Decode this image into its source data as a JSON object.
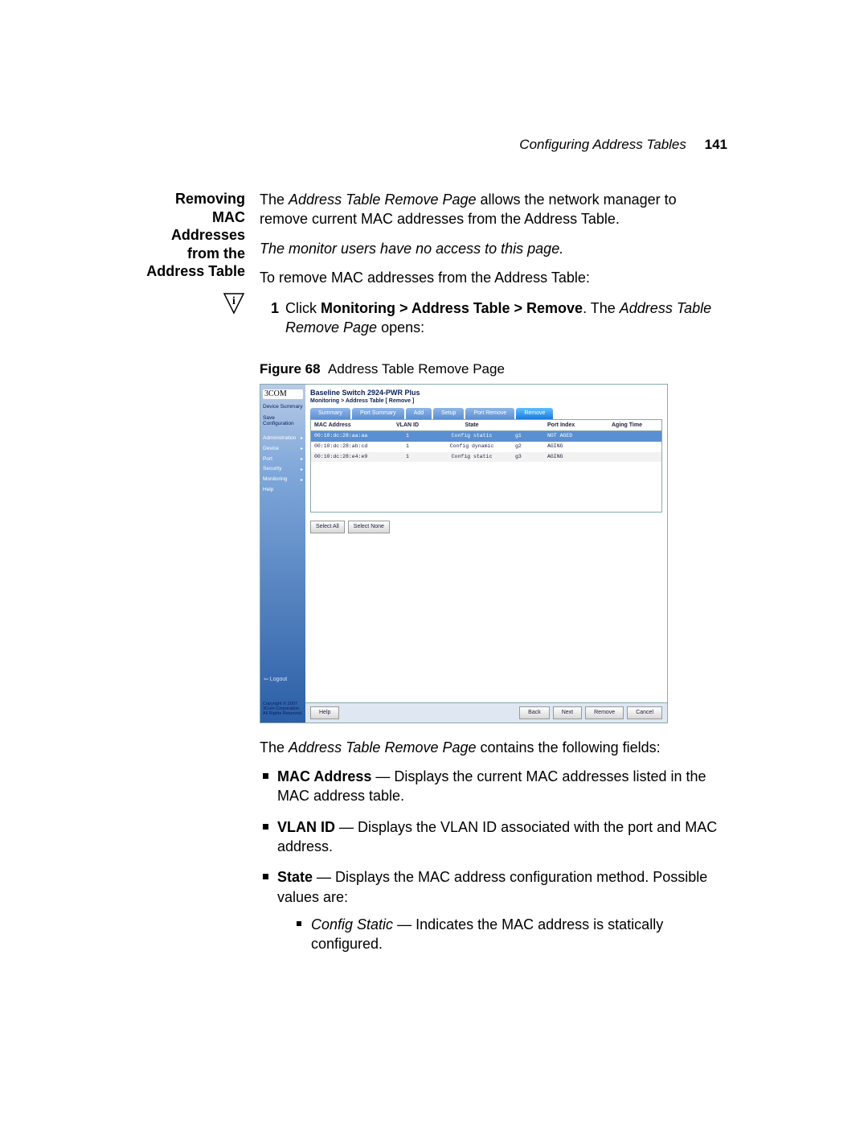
{
  "running_head": {
    "title": "Configuring Address Tables",
    "page": "141"
  },
  "side_heading": "Removing MAC Addresses from the Address Table",
  "intro": {
    "p1_a": "The ",
    "p1_em": "Address Table Remove Page",
    "p1_b": " allows the network manager to remove current MAC addresses from the Address Table.",
    "p2": "The monitor users have no access to this page.",
    "p3": "To remove MAC addresses from the Address Table:"
  },
  "step1": {
    "num": "1",
    "a": "Click ",
    "bold": "Monitoring > Address Table > Remove",
    "b": ". The ",
    "em": "Address Table Remove Page",
    "c": " opens:"
  },
  "fig_caption": {
    "label": "Figure 68",
    "text": "Address Table Remove Page"
  },
  "fig": {
    "logo": "3COM",
    "side_top": [
      "Device Summary",
      "Save Configuration"
    ],
    "side_nav": [
      "Administration",
      "Device",
      "Port",
      "Security",
      "Monitoring",
      "Help"
    ],
    "logout": "⇦ Logout",
    "copyright": "Copyright © 2007\n3Com Corporation.\nAll Rights Reserved.",
    "title": "Baseline Switch 2924-PWR Plus",
    "breadcrumb": "Monitoring > Address Table [ Remove ]",
    "tabs": [
      "Summary",
      "Port Summary",
      "Add",
      "Setup",
      "Port Remove",
      "Remove"
    ],
    "active_tab_index": 5,
    "headers": [
      "MAC Address",
      "VLAN ID",
      "State",
      "",
      "Port Index",
      "Aging Time"
    ],
    "rows": [
      {
        "mac": "00:10:dc:28:aa:aa",
        "vlan": "1",
        "state": "Config static",
        "g": "g1",
        "port": "NOT AGED",
        "age": ""
      },
      {
        "mac": "00:10:dc:28:ab:cd",
        "vlan": "1",
        "state": "Config dynamic",
        "g": "g2",
        "port": "AGING",
        "age": ""
      },
      {
        "mac": "00:10:dc:28:e4:e9",
        "vlan": "1",
        "state": "Config static",
        "g": "g3",
        "port": "AGING",
        "age": ""
      }
    ],
    "sel_all": "Select All",
    "sel_none": "Select None",
    "footer_help": "Help",
    "footer_btns": [
      "Back",
      "Next",
      "Remove",
      "Cancel"
    ]
  },
  "after_fig_intro_a": "The ",
  "after_fig_intro_em": "Address Table Remove Page",
  "after_fig_intro_b": " contains the following fields:",
  "fields": [
    {
      "name": "MAC Address",
      "desc": " — Displays the current MAC addresses listed in the MAC address table."
    },
    {
      "name": "VLAN ID",
      "desc": " — Displays the VLAN ID associated with the port and MAC address."
    },
    {
      "name": "State",
      "desc": " — Displays the MAC address configuration method. Possible values are:"
    }
  ],
  "sub": {
    "name": "Config Static",
    "desc": " — Indicates the MAC address is statically configured."
  }
}
